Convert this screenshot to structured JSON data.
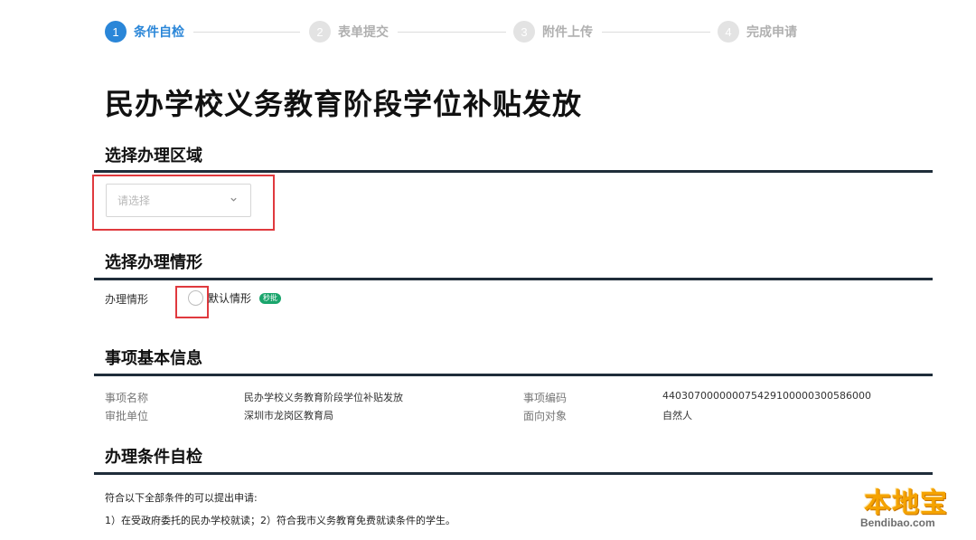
{
  "stepper": {
    "steps": [
      {
        "num": "1",
        "label": "条件自检"
      },
      {
        "num": "2",
        "label": "表单提交"
      },
      {
        "num": "3",
        "label": "附件上传"
      },
      {
        "num": "4",
        "label": "完成申请"
      }
    ],
    "active_step": 1
  },
  "page_title": "民办学校义务教育阶段学位补贴发放",
  "area_section": {
    "title": "选择办理区域",
    "select_placeholder": "请选择",
    "select_icon": "chevron-down-icon"
  },
  "situation_section": {
    "title": "选择办理情形",
    "field_label": "办理情形",
    "option_label": "默认情形",
    "option_badge": "秒批",
    "option_checked": false
  },
  "info_section": {
    "title": "事项基本信息",
    "items": [
      {
        "key": "事项名称",
        "value": "民办学校义务教育阶段学位补贴发放"
      },
      {
        "key": "事项编码",
        "value": "4403070000000754291000003005860​00"
      },
      {
        "key": "审批单位",
        "value": "深圳市龙岗区教育局"
      },
      {
        "key": "面向对象",
        "value": "自然人"
      }
    ]
  },
  "conditions_section": {
    "title": "办理条件自检",
    "intro": "符合以下全部条件的可以提出申请:",
    "items": "1）在受政府委托的民办学校就读；2）符合我市义务教育免费就读条件的学生。"
  },
  "watermark": {
    "main": "本地宝",
    "sub": "Bendibao.com"
  },
  "colors": {
    "accent": "#2a86d8",
    "highlight": "#e0393e",
    "badge": "#1aa56c",
    "rule": "#1f2d3a"
  }
}
